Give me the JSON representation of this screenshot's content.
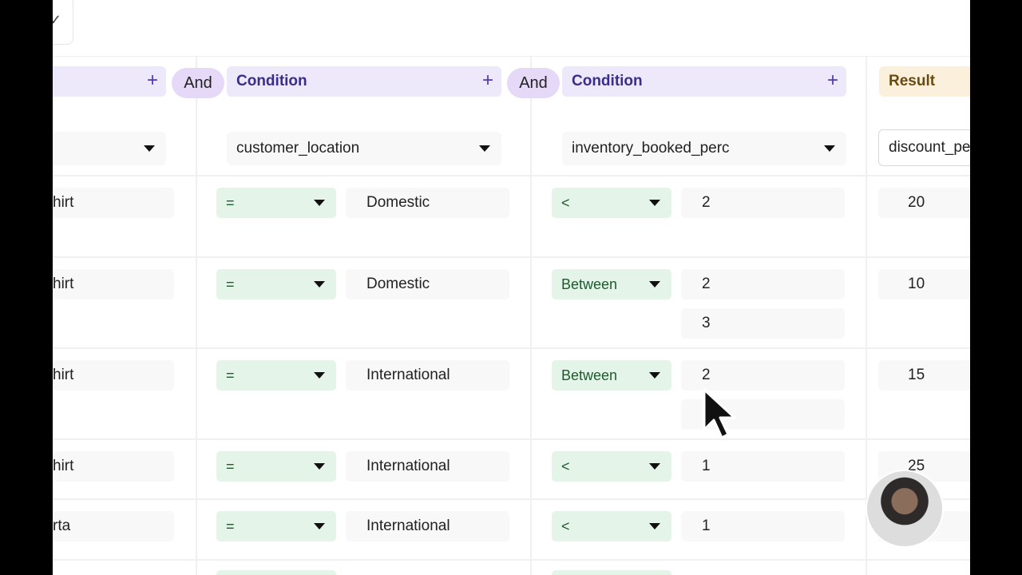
{
  "headers": {
    "and_label": "And",
    "condition_label": "Condition",
    "plus_label": "+",
    "result_label": "Result"
  },
  "columns": {
    "col1": "",
    "col2": "customer_location",
    "col3": "inventory_booked_perc",
    "result": "discount_pe"
  },
  "rows": [
    {
      "c0": "hirt",
      "op1": "=",
      "v1": "Domestic",
      "op2": "<",
      "v2a": "2",
      "v2b": null,
      "res": "20"
    },
    {
      "c0": "hirt",
      "op1": "=",
      "v1": "Domestic",
      "op2": "Between",
      "v2a": "2",
      "v2b": "3",
      "res": "10"
    },
    {
      "c0": "hirt",
      "op1": "=",
      "v1": "International",
      "op2": "Between",
      "v2a": "2",
      "v2b": "",
      "res": "15"
    },
    {
      "c0": "hirt",
      "op1": "=",
      "v1": "International",
      "op2": "<",
      "v2a": "1",
      "v2b": null,
      "res": "25"
    },
    {
      "c0": "rta",
      "op1": "=",
      "v1": "International",
      "op2": "<",
      "v2a": "1",
      "v2b": null,
      "res": ""
    }
  ],
  "icons": {
    "toolbar": "chevron-down-icon",
    "cursor": "mouse-pointer-icon",
    "avatar": "presenter-webcam"
  }
}
